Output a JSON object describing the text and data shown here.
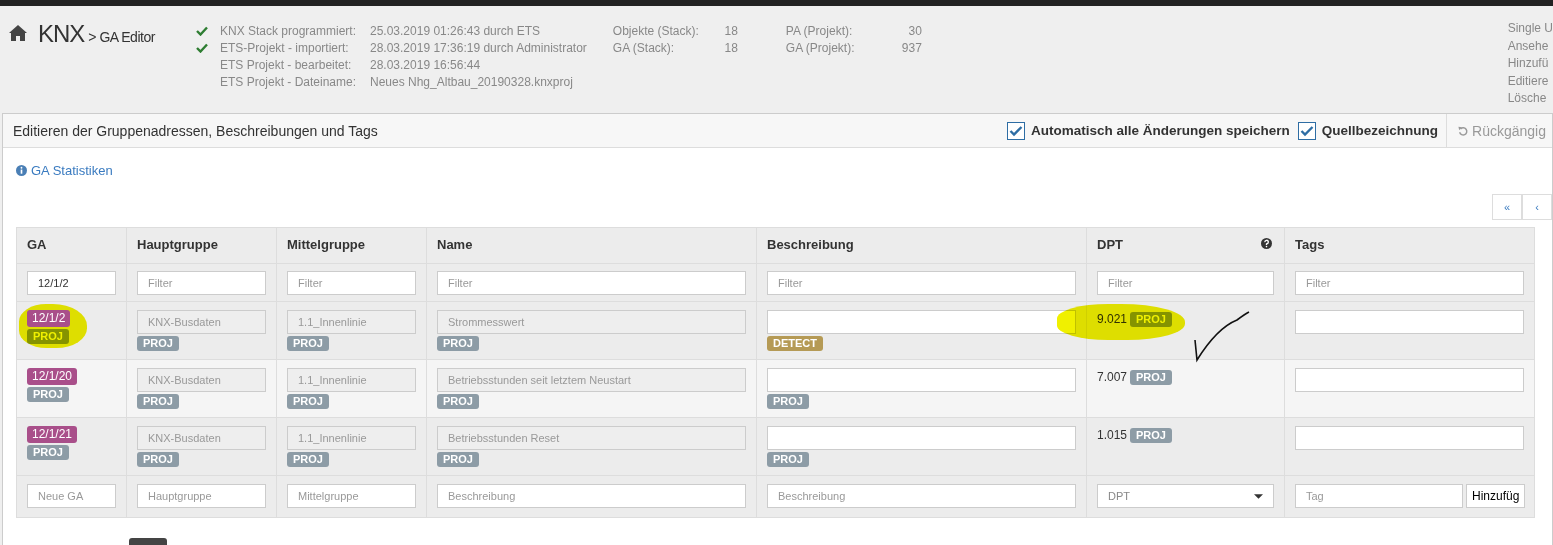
{
  "header": {
    "title": "KNX",
    "subtitle": "> GA Editor",
    "status": [
      {
        "ok": true,
        "label": "KNX Stack programmiert:",
        "value": "25.03.2019 01:26:43 durch ETS"
      },
      {
        "ok": true,
        "label": "ETS-Projekt - importiert:",
        "value": "28.03.2019 17:36:19 durch Administrator"
      },
      {
        "ok": false,
        "label": "ETS Projekt - bearbeitet:",
        "value": "28.03.2019 16:56:44"
      },
      {
        "ok": false,
        "label": "ETS Projekt - Dateiname:",
        "value": "Neues Nhg_Altbau_20190328.knxproj"
      }
    ],
    "stats": [
      [
        {
          "label": "Objekte (Stack):",
          "value": "18"
        },
        {
          "label": "GA (Stack):",
          "value": "18"
        }
      ],
      [
        {
          "label": "PA (Projekt):",
          "value": "30"
        },
        {
          "label": "GA (Projekt):",
          "value": "937"
        }
      ]
    ],
    "menu": [
      "Single U",
      "Ansehe",
      "Hinzufü",
      "Editiere",
      "Lösche"
    ]
  },
  "panel": {
    "title": "Editieren der Gruppenadressen, Beschreibungen und Tags",
    "options": [
      {
        "label": "Automatisch alle Änderungen speichern",
        "checked": true
      },
      {
        "label": "Quellbezeichnung",
        "checked": true
      }
    ],
    "undo": {
      "label": "Rückgängig",
      "disabled": true
    },
    "link": "GA Statistiken",
    "pagination": [
      "«",
      "‹"
    ]
  },
  "table": {
    "columns": [
      {
        "label": "GA"
      },
      {
        "label": "Hauptgruppe"
      },
      {
        "label": "Mittelgruppe"
      },
      {
        "label": "Name"
      },
      {
        "label": "Beschreibung"
      },
      {
        "label": "DPT",
        "help": true
      },
      {
        "label": "Tags"
      }
    ],
    "filters": [
      {
        "value": "12/1/2"
      },
      {
        "placeholder": "Filter"
      },
      {
        "placeholder": "Filter"
      },
      {
        "placeholder": "Filter"
      },
      {
        "placeholder": "Filter"
      },
      {
        "placeholder": "Filter"
      },
      {
        "placeholder": "Filter"
      }
    ],
    "rows": [
      {
        "marked": true,
        "ga": {
          "text": "12/1/2",
          "color": "#a94f8a",
          "badge": "PROJ"
        },
        "hauptgruppe": {
          "value": "KNX-Busdaten",
          "badge": "PROJ"
        },
        "mittelgruppe": {
          "value": "1.1_Innenlinie",
          "badge": "PROJ"
        },
        "name": {
          "value": "Strommesswert",
          "badge": "PROJ"
        },
        "beschreibung": {
          "badge": "DETECT",
          "kind": "detect"
        },
        "dpt": {
          "text": "9.021",
          "badge": "PROJ"
        }
      },
      {
        "marked": false,
        "ga": {
          "text": "12/1/20",
          "color": "#a94f8a",
          "badge": "PROJ"
        },
        "hauptgruppe": {
          "value": "KNX-Busdaten",
          "badge": "PROJ"
        },
        "mittelgruppe": {
          "value": "1.1_Innenlinie",
          "badge": "PROJ"
        },
        "name": {
          "value": "Betriebsstunden seit letztem Neustart",
          "badge": "PROJ"
        },
        "beschreibung": {
          "badge": "PROJ",
          "kind": "proj"
        },
        "dpt": {
          "text": "7.007",
          "badge": "PROJ"
        }
      },
      {
        "marked": false,
        "ga": {
          "text": "12/1/21",
          "color": "#a94f8a",
          "badge": "PROJ"
        },
        "hauptgruppe": {
          "value": "KNX-Busdaten",
          "badge": "PROJ"
        },
        "mittelgruppe": {
          "value": "1.1_Innenlinie",
          "badge": "PROJ"
        },
        "name": {
          "value": "Betriebsstunden Reset",
          "badge": "PROJ"
        },
        "beschreibung": {
          "badge": "PROJ",
          "kind": "proj"
        },
        "dpt": {
          "text": "1.015",
          "badge": "PROJ"
        }
      }
    ],
    "new_row": {
      "placeholders": [
        "Neue GA",
        "Hauptgruppe",
        "Mittelgruppe",
        "Beschreibung",
        "Beschreibung"
      ],
      "dpt_placeholder": "DPT",
      "tag_placeholder": "Tag",
      "add_button": "Hinzufüg"
    }
  }
}
